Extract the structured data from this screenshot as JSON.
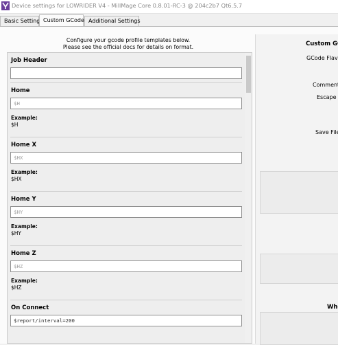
{
  "window": {
    "title": "Device settings for LOWRIDER V4 - MillMage Core 0.8.01-RC-3 @ 204c2b7 Qt6.5.7",
    "accent": "#6a3f9a"
  },
  "tabs": [
    {
      "label": "Basic Settings",
      "active": false
    },
    {
      "label": "Custom GCode",
      "active": true
    },
    {
      "label": "Additional Settings",
      "active": false
    }
  ],
  "intro": {
    "line1": "Configure your gcode profile templates below.",
    "line2": "Please see the official docs for details on format."
  },
  "sections": [
    {
      "title": "Job Header",
      "value": "",
      "placeholder": ""
    },
    {
      "title": "Home",
      "value": "",
      "placeholder": "$H",
      "example_label": "Example:",
      "example": "$H"
    },
    {
      "title": "Home X",
      "value": "",
      "placeholder": "$HX",
      "example_label": "Example:",
      "example": "$HX"
    },
    {
      "title": "Home Y",
      "value": "",
      "placeholder": "$HY",
      "example_label": "Example:",
      "example": "$HY"
    },
    {
      "title": "Home Z",
      "value": "",
      "placeholder": "$HZ",
      "example_label": "Example:",
      "example": "$HZ"
    },
    {
      "title": "On Connect",
      "value": "$report/interval=200",
      "placeholder": ""
    }
  ],
  "right_panel": {
    "heading": "Custom GC",
    "flavor_label": "GCode Flavor",
    "comment_label": "Comment C",
    "escape_label": "Escape C",
    "save_label": "Save File E",
    "lower_heading": "Whe"
  }
}
